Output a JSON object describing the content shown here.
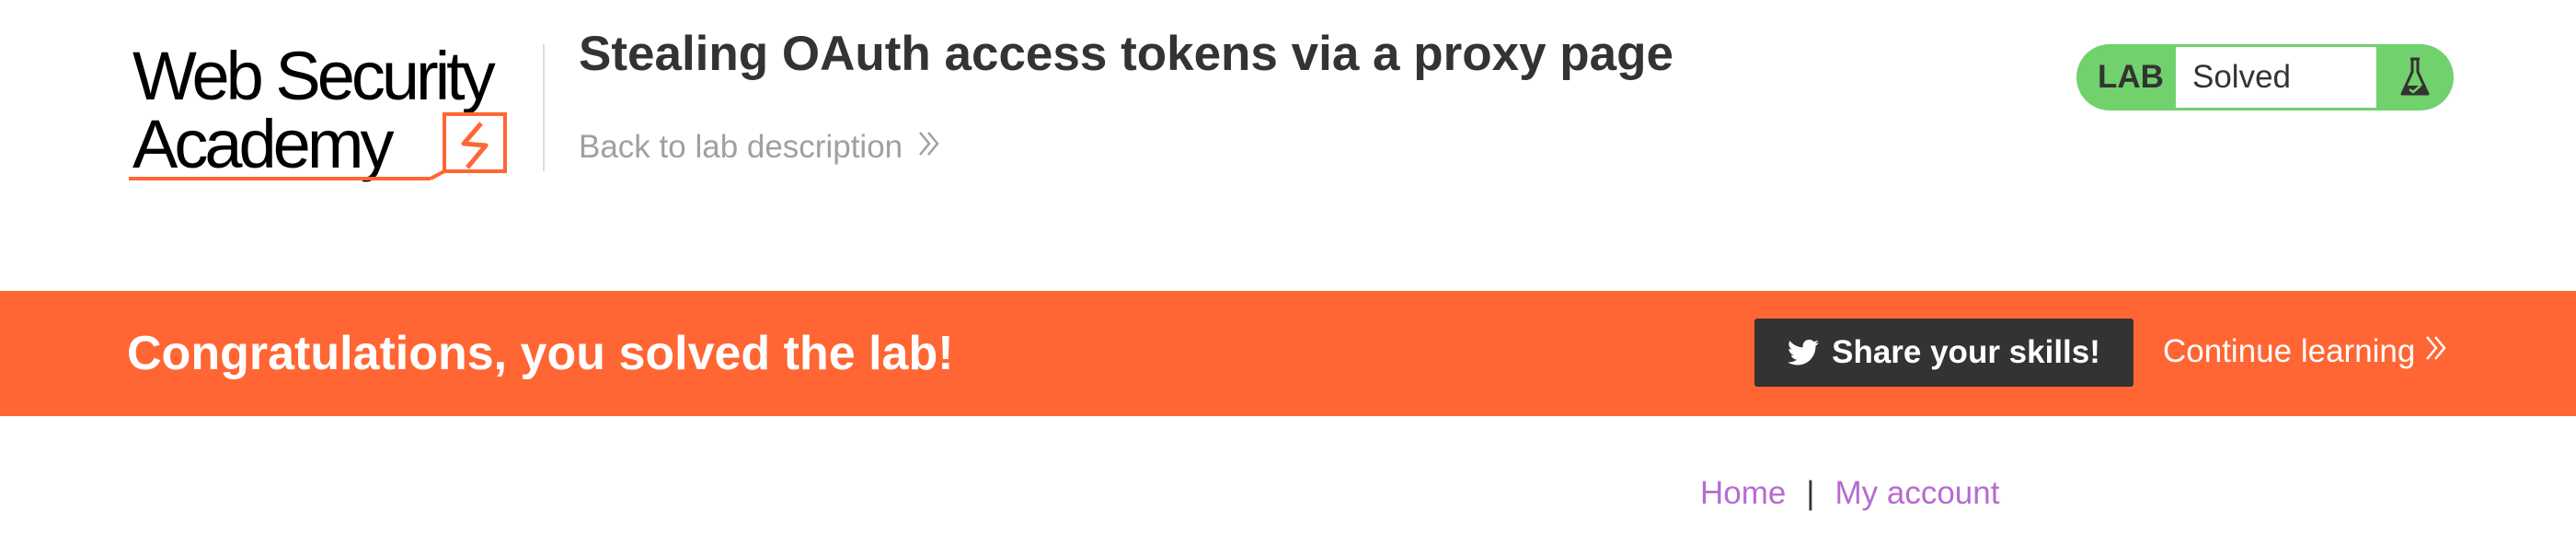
{
  "header": {
    "logo_text": "Web Security Academy",
    "lab_title": "Stealing OAuth access tokens via a proxy page",
    "back_link": "Back to lab description",
    "back_icon": "double-chevron-right-icon"
  },
  "status": {
    "label": "LAB",
    "state": "Solved",
    "icon": "flask-icon",
    "color": "#70d16d"
  },
  "banner": {
    "message": "Congratulations, you solved the lab!",
    "share_label": "Share your skills!",
    "share_icon": "twitter-icon",
    "continue_label": "Continue learning",
    "continue_icon": "double-chevron-right-icon",
    "color": "#ff6633"
  },
  "nav": {
    "home": "Home",
    "separator": "|",
    "account": "My account",
    "link_color": "#b66bd1"
  }
}
